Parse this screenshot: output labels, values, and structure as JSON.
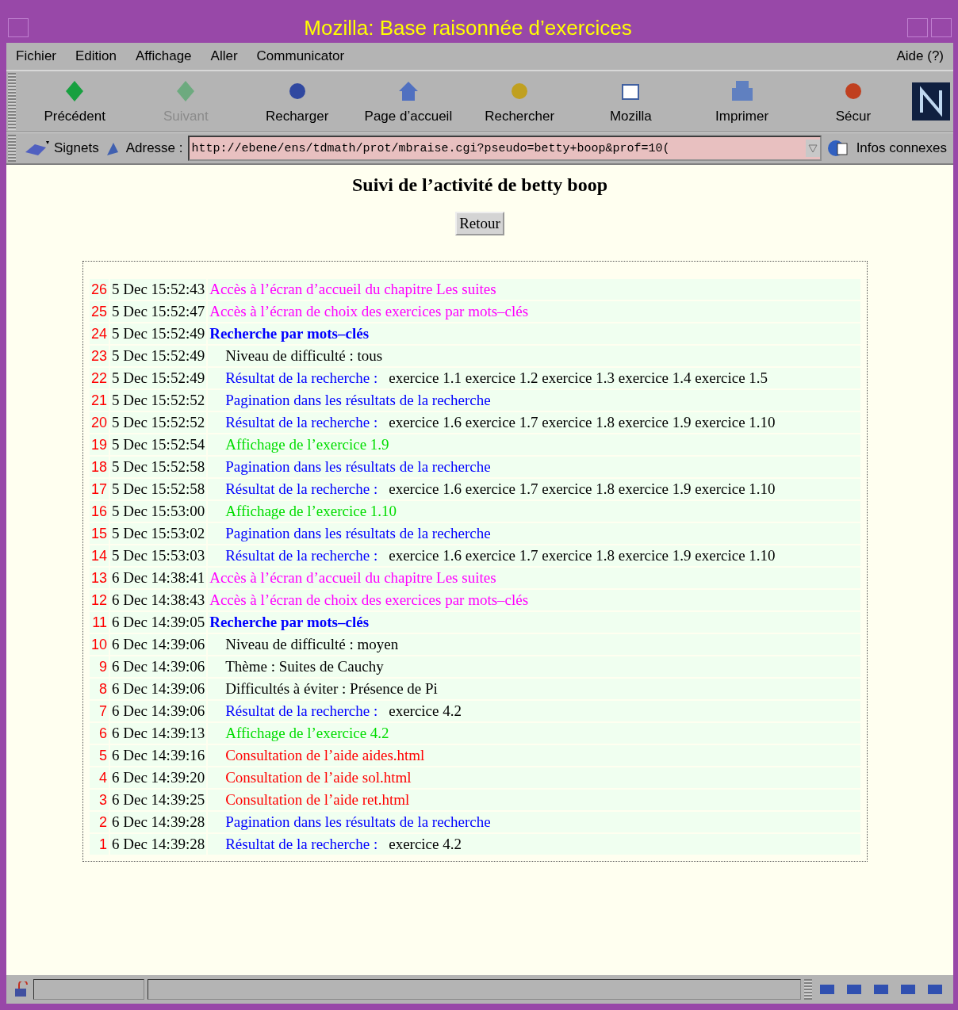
{
  "window": {
    "title": "Mozilla: Base raisonnée d’exercices"
  },
  "menu": {
    "items": [
      "Fichier",
      "Edition",
      "Affichage",
      "Aller",
      "Communicator"
    ],
    "help": "Aide (?)"
  },
  "toolbar": [
    {
      "label": "Précédent",
      "kind": "back",
      "disabled": false
    },
    {
      "label": "Suivant",
      "kind": "forward",
      "disabled": true
    },
    {
      "label": "Recharger",
      "kind": "reload",
      "disabled": false
    },
    {
      "label": "Page d’accueil",
      "kind": "home",
      "disabled": false
    },
    {
      "label": "Rechercher",
      "kind": "search",
      "disabled": false
    },
    {
      "label": "Mozilla",
      "kind": "my",
      "disabled": false
    },
    {
      "label": "Imprimer",
      "kind": "print",
      "disabled": false
    },
    {
      "label": "Sécur",
      "kind": "security",
      "disabled": false
    }
  ],
  "location_bar": {
    "bookmarks": "Signets",
    "address_label": "Adresse :",
    "url": "http://ebene/ens/tdmath/prot/mbraise.cgi?pseudo=betty+boop&prof=10(",
    "related": "Infos connexes"
  },
  "page": {
    "heading": "Suivi de l’activité de betty boop",
    "back_button": "Retour",
    "rows": [
      {
        "num": "26",
        "time": "5 Dec 15:52:43",
        "kind": "access",
        "text": "Accès à l’écran d’accueil du chapitre Les suites"
      },
      {
        "num": "25",
        "time": "5 Dec 15:52:47",
        "kind": "access",
        "text": "Accès à l’écran de choix des exercices par mots–clés"
      },
      {
        "num": "24",
        "time": "5 Dec 15:52:49",
        "kind": "search",
        "text": "Recherche par mots–clés"
      },
      {
        "num": "23",
        "time": "5 Dec 15:52:49",
        "kind": "criterion",
        "text": "Niveau de difficulté : tous"
      },
      {
        "num": "22",
        "time": "5 Dec 15:52:49",
        "kind": "result",
        "text": "Résultat de la recherche :",
        "detail": "exercice 1.1 exercice 1.2 exercice 1.3 exercice 1.4 exercice 1.5"
      },
      {
        "num": "21",
        "time": "5 Dec 15:52:52",
        "kind": "pagination",
        "text": "Pagination dans les résultats de la recherche"
      },
      {
        "num": "20",
        "time": "5 Dec 15:52:52",
        "kind": "result",
        "text": "Résultat de la recherche :",
        "detail": "exercice 1.6 exercice 1.7 exercice 1.8 exercice 1.9 exercice 1.10"
      },
      {
        "num": "19",
        "time": "5 Dec 15:52:54",
        "kind": "display",
        "text": "Affichage de l’exercice 1.9"
      },
      {
        "num": "18",
        "time": "5 Dec 15:52:58",
        "kind": "pagination",
        "text": "Pagination dans les résultats de la recherche"
      },
      {
        "num": "17",
        "time": "5 Dec 15:52:58",
        "kind": "result",
        "text": "Résultat de la recherche :",
        "detail": "exercice 1.6 exercice 1.7 exercice 1.8 exercice 1.9 exercice 1.10"
      },
      {
        "num": "16",
        "time": "5 Dec 15:53:00",
        "kind": "display",
        "text": "Affichage de l’exercice 1.10"
      },
      {
        "num": "15",
        "time": "5 Dec 15:53:02",
        "kind": "pagination",
        "text": "Pagination dans les résultats de la recherche"
      },
      {
        "num": "14",
        "time": "5 Dec 15:53:03",
        "kind": "result",
        "text": "Résultat de la recherche :",
        "detail": "exercice 1.6 exercice 1.7 exercice 1.8 exercice 1.9 exercice 1.10"
      },
      {
        "num": "13",
        "time": "6 Dec 14:38:41",
        "kind": "access",
        "text": "Accès à l’écran d’accueil du chapitre Les suites"
      },
      {
        "num": "12",
        "time": "6 Dec 14:38:43",
        "kind": "access",
        "text": "Accès à l’écran de choix des exercices par mots–clés"
      },
      {
        "num": "11",
        "time": "6 Dec 14:39:05",
        "kind": "search",
        "text": "Recherche par mots–clés"
      },
      {
        "num": "10",
        "time": "6 Dec 14:39:06",
        "kind": "criterion",
        "text": "Niveau de difficulté : moyen"
      },
      {
        "num": "9",
        "time": "6 Dec 14:39:06",
        "kind": "criterion",
        "text": "Thème : Suites de Cauchy"
      },
      {
        "num": "8",
        "time": "6 Dec 14:39:06",
        "kind": "criterion",
        "text": "Difficultés à éviter : Présence de Pi"
      },
      {
        "num": "7",
        "time": "6 Dec 14:39:06",
        "kind": "result",
        "text": "Résultat de la recherche :",
        "detail": "exercice 4.2"
      },
      {
        "num": "6",
        "time": "6 Dec 14:39:13",
        "kind": "display",
        "text": "Affichage de l’exercice 4.2"
      },
      {
        "num": "5",
        "time": "6 Dec 14:39:16",
        "kind": "help",
        "text": "Consultation de l’aide aides.html"
      },
      {
        "num": "4",
        "time": "6 Dec 14:39:20",
        "kind": "help",
        "text": "Consultation de l’aide sol.html"
      },
      {
        "num": "3",
        "time": "6 Dec 14:39:25",
        "kind": "help",
        "text": "Consultation de l’aide ret.html"
      },
      {
        "num": "2",
        "time": "6 Dec 14:39:28",
        "kind": "pagination",
        "text": "Pagination dans les résultats de la recherche"
      },
      {
        "num": "1",
        "time": "6 Dec 14:39:28",
        "kind": "result",
        "text": "Résultat de la recherche :",
        "detail": "exercice 4.2"
      }
    ]
  }
}
